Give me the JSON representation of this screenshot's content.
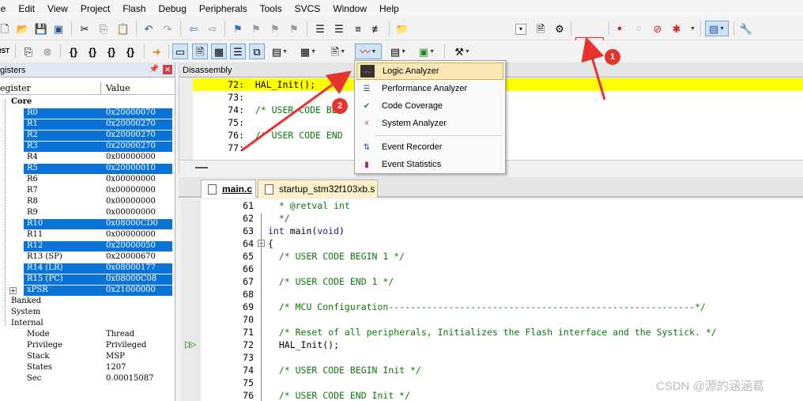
{
  "menubar": [
    "le",
    "Edit",
    "View",
    "Project",
    "Flash",
    "Debug",
    "Peripherals",
    "Tools",
    "SVCS",
    "Window",
    "Help"
  ],
  "registers": {
    "title": "gisters",
    "col_register": "egister",
    "col_value": "Value",
    "core_label": "Core",
    "rows": [
      {
        "name": "R0",
        "value": "0x20000070",
        "sel": true
      },
      {
        "name": "R1",
        "value": "0x20000270",
        "sel": true
      },
      {
        "name": "R2",
        "value": "0x20000270",
        "sel": true
      },
      {
        "name": "R3",
        "value": "0x20000270",
        "sel": true
      },
      {
        "name": "R4",
        "value": "0x00000000",
        "sel": false
      },
      {
        "name": "R5",
        "value": "0x20000010",
        "sel": true
      },
      {
        "name": "R6",
        "value": "0x00000000",
        "sel": false
      },
      {
        "name": "R7",
        "value": "0x00000000",
        "sel": false
      },
      {
        "name": "R8",
        "value": "0x00000000",
        "sel": false
      },
      {
        "name": "R9",
        "value": "0x00000000",
        "sel": false
      },
      {
        "name": "R10",
        "value": "0x08000CD0",
        "sel": true
      },
      {
        "name": "R11",
        "value": "0x00000000",
        "sel": false
      },
      {
        "name": "R12",
        "value": "0x20000050",
        "sel": true
      },
      {
        "name": "R13 (SP)",
        "value": "0x20000670",
        "sel": false
      },
      {
        "name": "R14 (LR)",
        "value": "0x08000177",
        "sel": true
      },
      {
        "name": "R15 (PC)",
        "value": "0x08000C08",
        "sel": true
      },
      {
        "name": "xPSR",
        "value": "0x21000000",
        "sel": true
      }
    ],
    "groups": [
      "Banked",
      "System",
      "Internal"
    ],
    "internal": [
      {
        "name": "Mode",
        "value": "Thread"
      },
      {
        "name": "Privilege",
        "value": "Privileged"
      },
      {
        "name": "Stack",
        "value": "MSP"
      },
      {
        "name": "States",
        "value": "1207"
      },
      {
        "name": "Sec",
        "value": "0.00015087"
      }
    ]
  },
  "disassembly": {
    "title": "Disassembly",
    "lines": [
      {
        "num": "72:",
        "text": "HAL_Init();",
        "current": true
      },
      {
        "num": "73:",
        "text": "",
        "current": false
      },
      {
        "num": "74:",
        "text": "/* USER CODE BEG",
        "current": false
      },
      {
        "num": "75:",
        "text": "",
        "current": false
      },
      {
        "num": "76:",
        "text": "/* USER CODE END",
        "current": false
      },
      {
        "num": "77:",
        "text": "",
        "current": false
      }
    ]
  },
  "tabs": [
    {
      "label": "main.c",
      "active": true
    },
    {
      "label": "startup_stm32f103xb.s",
      "active": false
    }
  ],
  "editor": {
    "lines": [
      {
        "num": "61",
        "text": "  * @retval int",
        "kind": "cmt"
      },
      {
        "num": "62",
        "text": "  */",
        "kind": "cmt"
      },
      {
        "num": "63",
        "text": "int main(void)",
        "kind": "code"
      },
      {
        "num": "64",
        "text": "{",
        "kind": "code"
      },
      {
        "num": "65",
        "text": "  /* USER CODE BEGIN 1 */",
        "kind": "cmt"
      },
      {
        "num": "66",
        "text": "",
        "kind": "code"
      },
      {
        "num": "67",
        "text": "  /* USER CODE END 1 */",
        "kind": "cmt"
      },
      {
        "num": "68",
        "text": "",
        "kind": "code"
      },
      {
        "num": "69",
        "text": "  /* MCU Configuration--------------------------------------------------------*/",
        "kind": "cmt"
      },
      {
        "num": "70",
        "text": "",
        "kind": "code"
      },
      {
        "num": "71",
        "text": "  /* Reset of all peripherals, Initializes the Flash interface and the Systick. */",
        "kind": "cmt"
      },
      {
        "num": "72",
        "text": "  HAL_Init();",
        "kind": "code"
      },
      {
        "num": "73",
        "text": "",
        "kind": "code"
      },
      {
        "num": "74",
        "text": "  /* USER CODE BEGIN Init */",
        "kind": "cmt"
      },
      {
        "num": "75",
        "text": "",
        "kind": "code"
      },
      {
        "num": "76",
        "text": "  /* USER CODE END Init */",
        "kind": "cmt"
      }
    ]
  },
  "analysis_menu": {
    "items": [
      {
        "label": "Logic Analyzer",
        "icon": "logic-analyzer-icon",
        "highlighted": true
      },
      {
        "label": "Performance Analyzer",
        "icon": "performance-analyzer-icon",
        "highlighted": false
      },
      {
        "label": "Code Coverage",
        "icon": "code-coverage-icon",
        "highlighted": false
      },
      {
        "label": "System Analyzer",
        "icon": "system-analyzer-icon",
        "highlighted": false
      },
      {
        "label": "Event Recorder",
        "icon": "event-recorder-icon",
        "highlighted": false
      },
      {
        "label": "Event Statistics",
        "icon": "event-statistics-icon",
        "highlighted": false
      }
    ]
  },
  "annotations": {
    "badge1": "1",
    "badge2": "2"
  },
  "watermark": "CSDN @源的涵涵葛",
  "colors": {
    "selection": "#0a74d6",
    "current_line": "#ffff00",
    "comment": "#0a7a0a",
    "annotation_red": "#e8322c",
    "menu_highlight": "#fbe6b6"
  }
}
